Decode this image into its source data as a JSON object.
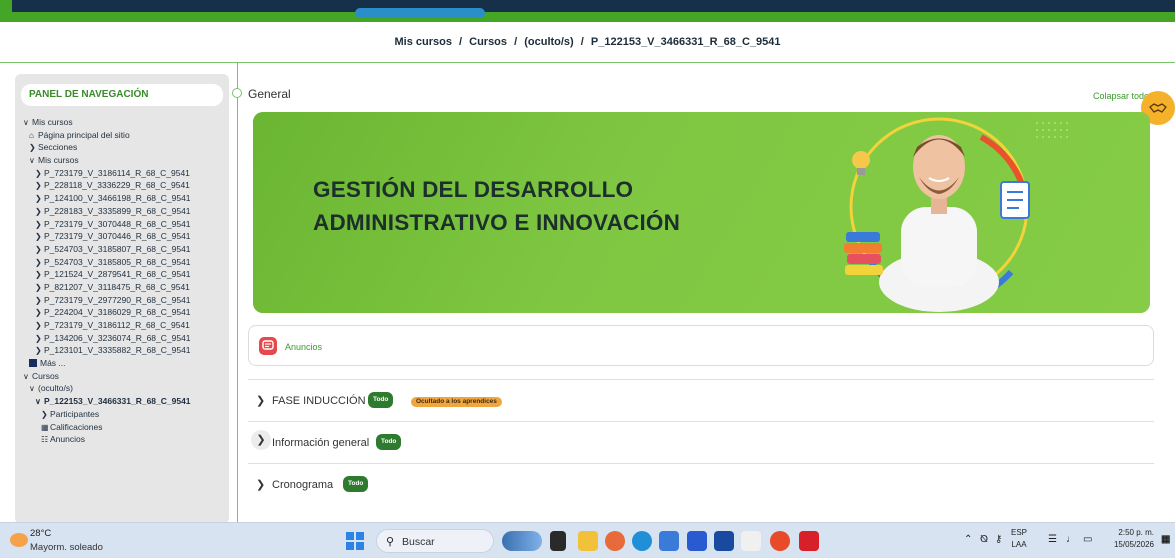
{
  "breadcrumb": {
    "items": [
      "Mis cursos",
      "Cursos",
      "(oculto/s)",
      "P_122153_V_3466331_R_68_C_9541"
    ],
    "separator": "/"
  },
  "sidebar": {
    "title": "PANEL DE NAVEGACIÓN",
    "tree": [
      {
        "chevron": "down",
        "label": "Mis cursos"
      },
      {
        "chevron": "home",
        "label": "Página principal del sitio"
      },
      {
        "chevron": "right",
        "label": "Secciones"
      },
      {
        "chevron": "down",
        "label": "Mis cursos"
      },
      {
        "chevron": "right",
        "label": "P_723179_V_3186114_R_68_C_9541"
      },
      {
        "chevron": "right",
        "label": "P_228118_V_3336229_R_68_C_9541"
      },
      {
        "chevron": "right",
        "label": "P_124100_V_3466198_R_68_C_9541"
      },
      {
        "chevron": "right",
        "label": "P_228183_V_3335899_R_68_C_9541"
      },
      {
        "chevron": "right",
        "label": "P_723179_V_3070448_R_68_C_9541"
      },
      {
        "chevron": "right",
        "label": "P_723179_V_3070446_R_68_C_9541"
      },
      {
        "chevron": "right",
        "label": "P_524703_V_3185807_R_68_C_9541"
      },
      {
        "chevron": "right",
        "label": "P_524703_V_3185805_R_68_C_9541"
      },
      {
        "chevron": "right",
        "label": "P_121524_V_2879541_R_68_C_9541"
      },
      {
        "chevron": "right",
        "label": "P_821207_V_3118475_R_68_C_9541"
      },
      {
        "chevron": "right",
        "label": "P_723179_V_2977290_R_68_C_9541"
      },
      {
        "chevron": "right",
        "label": "P_224204_V_3186029_R_68_C_9541"
      },
      {
        "chevron": "right",
        "label": "P_723179_V_3186112_R_68_C_9541"
      },
      {
        "chevron": "right",
        "label": "P_134206_V_3236074_R_68_C_9541"
      },
      {
        "chevron": "right",
        "label": "P_123101_V_3335882_R_68_C_9541"
      },
      {
        "chevron": "square",
        "label": "Más ..."
      },
      {
        "chevron": "down",
        "label": "Cursos"
      },
      {
        "chevron": "down",
        "label": "(oculto/s)"
      },
      {
        "chevron": "down",
        "label": "P_122153_V_3466331_R_68_C_9541"
      },
      {
        "chevron": "right",
        "label": "Participantes"
      },
      {
        "chevron": "grid",
        "label": "Calificaciones"
      },
      {
        "chevron": "doc",
        "label": "Anuncios"
      }
    ]
  },
  "main": {
    "section_title": "General",
    "collapse_label": "Colapsar todo",
    "banner": {
      "line1": "GESTIÓN DEL DESARROLLO",
      "line2": "ADMINISTRATIVO E INNOVACIÓN"
    },
    "announcements_label": "Anuncios",
    "sections": [
      {
        "label": "FASE INDUCCIÓN",
        "badge": "Todo",
        "hidden_badge": "Ocultado a los aprendices"
      },
      {
        "label": "Información general",
        "badge": "Todo",
        "hidden_badge": ""
      },
      {
        "label": "Cronograma",
        "badge": "Todo",
        "hidden_badge": ""
      }
    ]
  },
  "taskbar": {
    "weather_temp": "28°C",
    "weather_desc": "Mayorm. soleado",
    "search_placeholder": "Buscar",
    "lang_line1": "ESP",
    "lang_line2": "LAA",
    "time": "2:50 p. m.",
    "date": "15/05/2026"
  },
  "colors": {
    "brand_green": "#45a526",
    "banner_green": "#79c33d",
    "badge_green": "#2e7a2e",
    "badge_orange": "#f0a640",
    "accent_orange": "#f6b12a"
  }
}
